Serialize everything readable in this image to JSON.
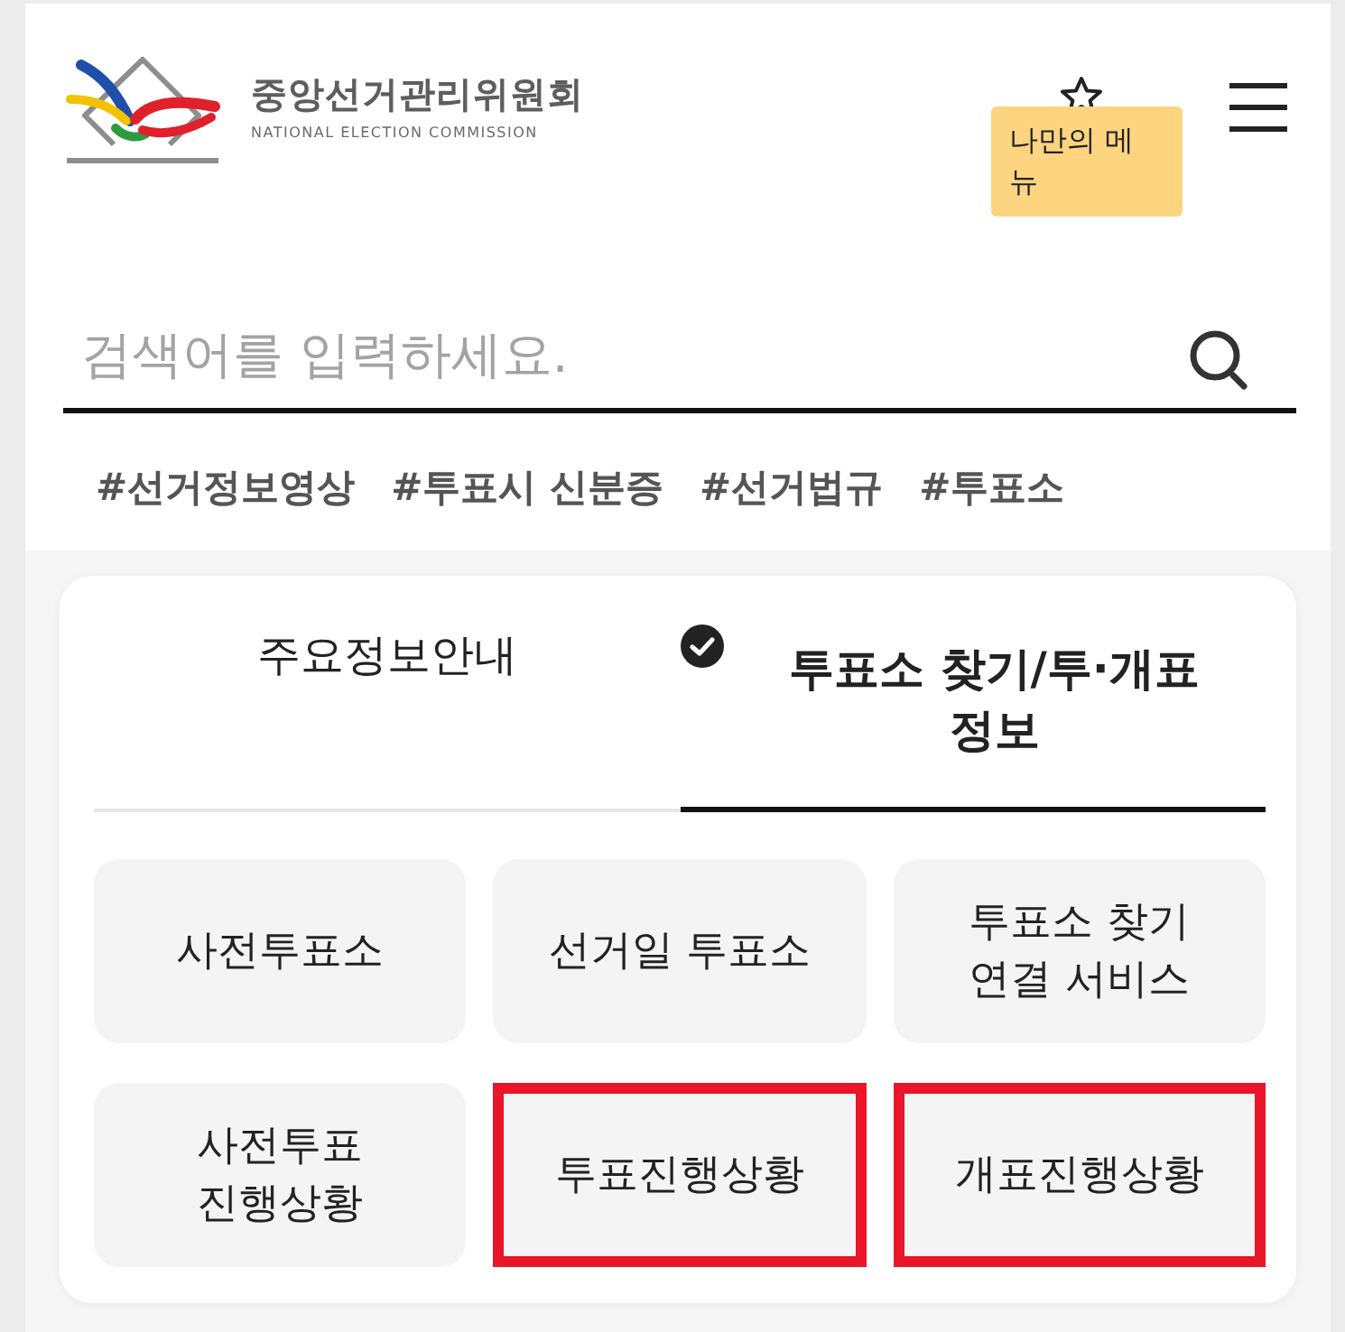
{
  "header": {
    "logo": {
      "title": "중앙선거관리위원회",
      "subtitle": "NATIONAL ELECTION COMMISSION"
    },
    "my_menu_tooltip": "나만의 메뉴"
  },
  "search": {
    "placeholder": "검색어를 입력하세요."
  },
  "hashtags": [
    "#선거정보영상",
    "#투표시 신분증",
    "#선거법규",
    "#투표소"
  ],
  "panel": {
    "tabs": [
      {
        "label": "주요정보안내",
        "selected": false
      },
      {
        "label": "투표소 찾기/투·개표 정보",
        "selected": true
      }
    ],
    "buttons": [
      {
        "label": "사전투표소",
        "highlighted": false
      },
      {
        "label": "선거일 투표소",
        "highlighted": false
      },
      {
        "label": "투표소 찾기 연결 서비스",
        "highlighted": false
      },
      {
        "label": "사전투표 진행상황",
        "highlighted": false
      },
      {
        "label": "투표진행상황",
        "highlighted": true
      },
      {
        "label": "개표진행상황",
        "highlighted": true
      }
    ]
  }
}
